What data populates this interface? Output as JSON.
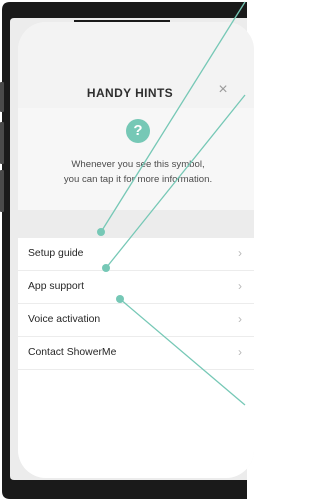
{
  "header": {
    "title": "HANDY HINTS",
    "close_label": "×"
  },
  "hint": {
    "badge": "?",
    "text_line1": "Whenever you see this symbol,",
    "text_line2": "you can tap it for more information."
  },
  "menu": {
    "items": [
      {
        "label": "Setup guide",
        "chevron": "›"
      },
      {
        "label": "App support",
        "chevron": "›"
      },
      {
        "label": "Voice activation",
        "chevron": "›"
      },
      {
        "label": "Contact ShowerMe",
        "chevron": "›"
      }
    ]
  },
  "colors": {
    "accent": "#76c8b6",
    "device_frame": "#1a1a1a",
    "screen_background": "#f7f7f7",
    "menu_background": "#ffffff"
  },
  "icons": {
    "help": "question-icon",
    "close": "close-icon",
    "chevron": "chevron-right-icon"
  }
}
